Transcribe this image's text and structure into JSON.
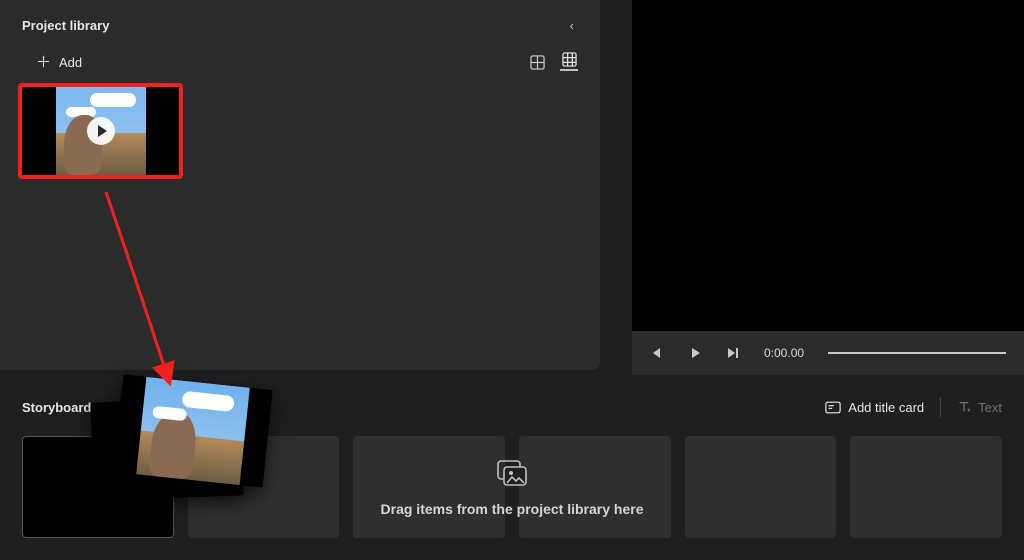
{
  "library": {
    "title": "Project library",
    "add_label": "Add",
    "collapse_glyph": "‹"
  },
  "preview": {
    "timecode": "0:00.00"
  },
  "storyboard": {
    "title": "Storyboard",
    "hint": "Drag items from the project library here",
    "actions": {
      "add_title_card": "Add title card",
      "text": "Text"
    }
  },
  "annotation": {
    "arrow_color": "#f32020",
    "clip_highlight_color": "#f32020"
  }
}
